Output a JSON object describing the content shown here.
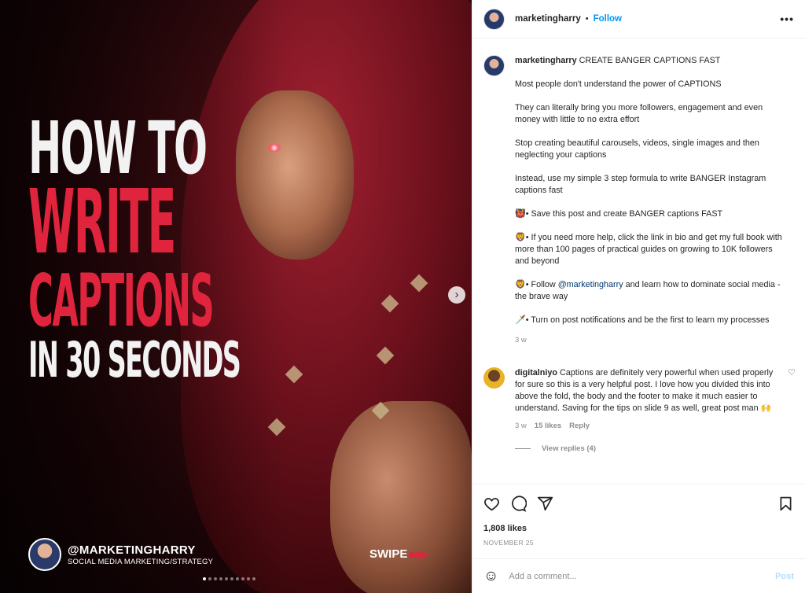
{
  "media": {
    "headline": {
      "line1": "HOW TO",
      "line2": "WRITE",
      "line3": "CAPTIONS",
      "line4": "IN 30 SECONDS"
    },
    "brand_handle": "@MARKETINGHARRY",
    "brand_subtitle": "SOCIAL MEDIA MARKETING/STRATEGY",
    "swipe_label": "SWIPE",
    "swipe_arrows": "▶▶▶",
    "next_icon": "chevron-right-icon",
    "dots_total": 10,
    "dot_active_index": 0
  },
  "header": {
    "username": "marketingharry",
    "separator": "•",
    "follow_label": "Follow",
    "more_label": "•••"
  },
  "caption": {
    "username": "marketingharry",
    "title": "CREATE BANGER CAPTIONS FAST",
    "p1": "Most people don't understand the power of CAPTIONS",
    "p2": "They can literally bring you more followers, engagement and even money with little to no extra effort",
    "p3": "Stop creating beautiful carousels, videos, single images and then neglecting your captions",
    "p4": "Instead, use my simple 3 step formula to write BANGER Instagram captions fast",
    "p5_emoji": "👹",
    "p5": "• Save this post and create BANGER captions FAST",
    "p6_emoji": "🦁",
    "p6": "• If you need more help, click the link in bio and get my full book with more than 100 pages of practical guides on growing to 10K followers and beyond",
    "p7_emoji": "🦁",
    "p7_pre": "• Follow ",
    "p7_mention": "@marketingharry",
    "p7_post": " and learn how to dominate social media - the brave way",
    "p8_emoji": "🗡️",
    "p8": "• Turn on post notifications and be the first to learn my processes",
    "age": "3 w"
  },
  "comment": {
    "username": "digitalniyo",
    "text": "Captions are definitely very powerful when used properly for sure so this is a very helpful post. I love how you divided this into above the fold, the body and the footer to make it much easier to understand. Saving for the tips on slide 9 as well, great post man",
    "emoji": "🙌",
    "age": "3 w",
    "likes": "15 likes",
    "reply_label": "Reply",
    "view_replies": "View replies (4)",
    "heart_icon": "♡"
  },
  "actions": {
    "likes": "1,808 likes",
    "date": "NOVEMBER 25"
  },
  "add_comment": {
    "placeholder": "Add a comment...",
    "post_label": "Post",
    "emoji_icon": "☺"
  }
}
